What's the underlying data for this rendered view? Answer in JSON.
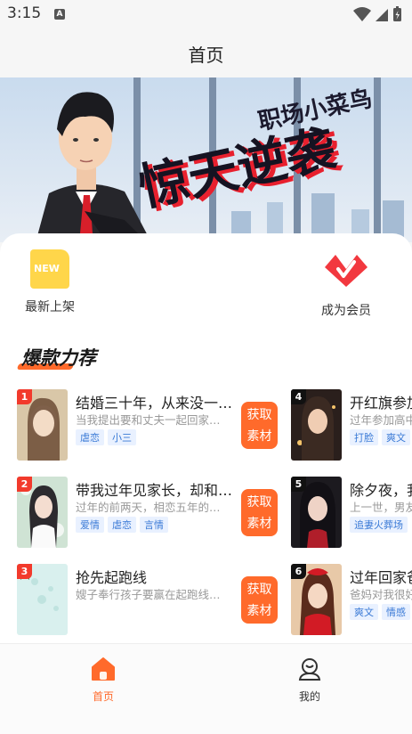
{
  "status_bar": {
    "time": "3:15",
    "notification_icon": "A"
  },
  "header": {
    "title": "首页"
  },
  "banner": {
    "line1": "职场小菜鸟",
    "line2": "惊天逆袭"
  },
  "quick_actions": [
    {
      "label": "最新上架",
      "icon": "new-badge-icon",
      "icon_text": "NEW"
    },
    {
      "label": "成为会员",
      "icon": "vip-crown-icon"
    }
  ],
  "section": {
    "title": "爆款力荐"
  },
  "colors": {
    "accent": "#ff6a2b",
    "tag_text": "#3a7ad6",
    "rank_red": "#f23a2c"
  },
  "books_left": [
    {
      "rank": "1",
      "title": "结婚三十年，从来没一…",
      "desc": "当我提出要和丈夫一起回家…",
      "tags": [
        "虐恋",
        "小三"
      ],
      "button": "获取\n素材"
    },
    {
      "rank": "2",
      "title": "带我过年见家长，却和…",
      "desc": "过年的前两天，相恋五年的…",
      "tags": [
        "爱情",
        "虐恋",
        "言情"
      ],
      "button": "获取\n素材"
    },
    {
      "rank": "3",
      "title": "抢先起跑线",
      "desc": "嫂子奉行孩子要赢在起跑线…",
      "tags": [],
      "button": "获取\n素材"
    }
  ],
  "books_right": [
    {
      "rank": "4",
      "title": "开红旗参加",
      "desc": "过年参加高中",
      "tags": [
        "打脸",
        "爽文"
      ]
    },
    {
      "rank": "5",
      "title": "除夕夜，我",
      "desc": "上一世，男友",
      "tags": [
        "追妻火葬场"
      ]
    },
    {
      "rank": "6",
      "title": "过年回家爸",
      "desc": "爸妈对我很好",
      "tags": [
        "爽文",
        "情感"
      ]
    }
  ],
  "tabbar": [
    {
      "label": "首页",
      "icon": "home-icon",
      "active": true
    },
    {
      "label": "我的",
      "icon": "profile-icon",
      "active": false
    }
  ]
}
